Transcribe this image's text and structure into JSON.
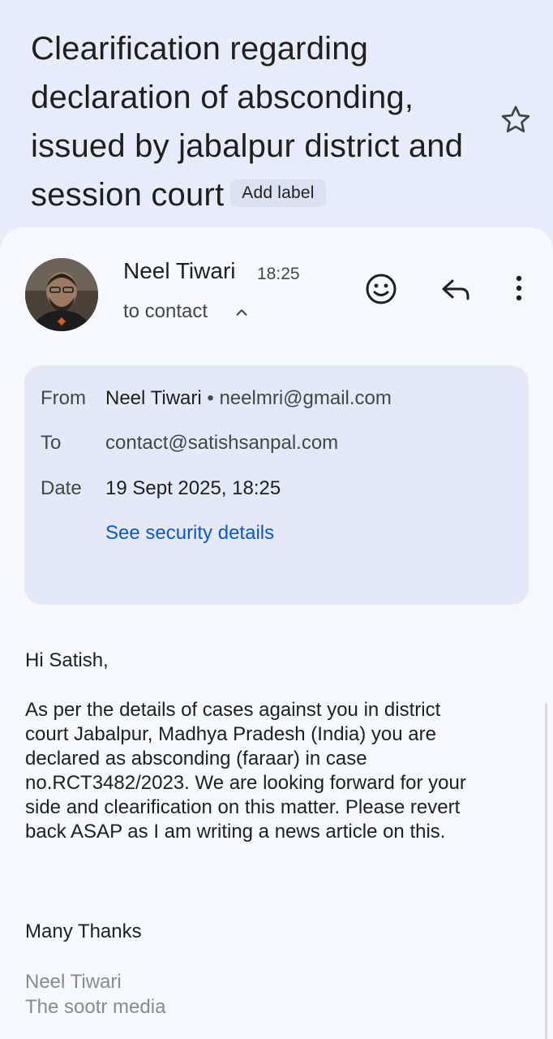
{
  "email": {
    "subject": "Clearification regarding declaration of absconding, issued by jabalpur district and session court",
    "add_label": "Add label",
    "sender": {
      "name": "Neel Tiwari",
      "time": "18:25",
      "to_summary": "to contact"
    },
    "details": {
      "from_label": "From",
      "from_name": "Neel Tiwari",
      "from_sep": "•",
      "from_email": "neelmri@gmail.com",
      "to_label": "To",
      "to_email": "contact@satishsanpal.com",
      "date_label": "Date",
      "date_value": "19 Sept 2025, 18:25",
      "security_link": "See security details"
    },
    "body": {
      "greeting": "Hi Satish,",
      "paragraph_lines": [
        "As per the details of cases against you in district",
        "court Jabalpur, Madhya Pradesh (India) you are",
        "declared as absconding (faraar) in case",
        "no.RCT3482/2023. We are looking forward for your",
        "side and clearification on this matter. Please revert",
        "back ASAP as I am writing a news article on this."
      ],
      "closing": "Many Thanks",
      "signature_name": "Neel Tiwari",
      "signature_org": "The sootr media"
    }
  },
  "icons": {
    "star": "star-outline-icon",
    "caret": "chevron-up-icon",
    "emoji": "emoji-reaction-icon",
    "reply": "reply-icon",
    "more": "more-vertical-icon"
  },
  "colors": {
    "header_bg": "#e8ebf8",
    "card_bg": "#f7f8fd",
    "details_bg": "#e4e8f7",
    "link": "#0b57d0",
    "signature": "#8a8a8a"
  }
}
